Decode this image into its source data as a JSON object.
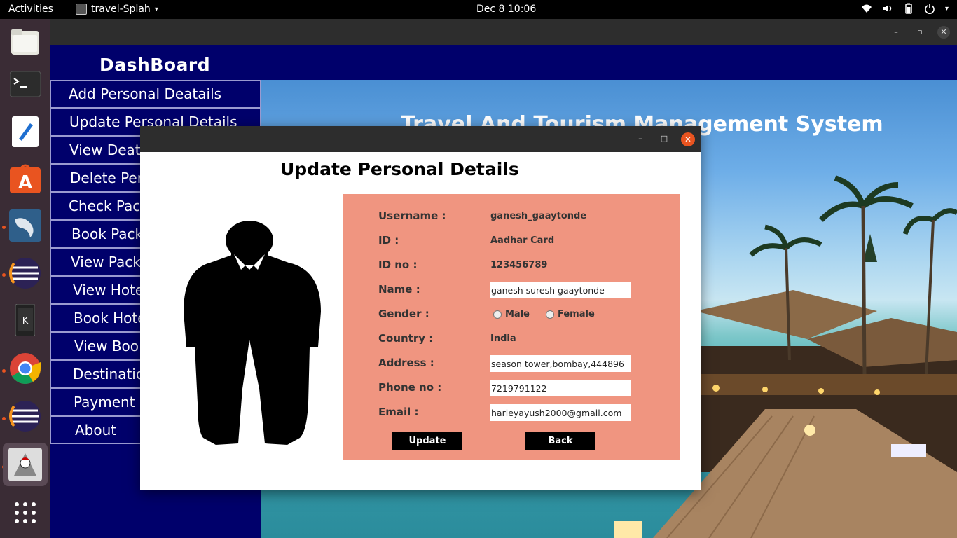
{
  "topbar": {
    "activities": "Activities",
    "app_name": "travel-Splah",
    "clock": "Dec 8  10:06"
  },
  "window": {
    "minimize": "–",
    "maximize": "▫",
    "close": "✕"
  },
  "sidebar": {
    "title": "DashBoard",
    "items": [
      {
        "label": "Add Personal Deatails"
      },
      {
        "label": "Update Personal Details"
      },
      {
        "label": "View Deat"
      },
      {
        "label": "Delete Per"
      },
      {
        "label": "Check Pac"
      },
      {
        "label": "Book Pack"
      },
      {
        "label": "View Pack"
      },
      {
        "label": "View Hote"
      },
      {
        "label": "Book Hote"
      },
      {
        "label": "View Boo"
      },
      {
        "label": "Destinatio"
      },
      {
        "label": "Payment"
      },
      {
        "label": "About"
      }
    ]
  },
  "scene": {
    "title": "Travel And Tourism Management System"
  },
  "dialog": {
    "heading": "Update Personal Details",
    "minimize": "–",
    "maximize": "□",
    "close": "✕",
    "form": {
      "username_label": "Username :",
      "username_value": "ganesh_gaaytonde",
      "id_label": "ID :",
      "id_value": "Aadhar Card",
      "idno_label": "ID no :",
      "idno_value": "123456789",
      "name_label": "Name :",
      "name_value": "ganesh suresh gaaytonde",
      "gender_label": "Gender :",
      "gender_options": [
        "Male",
        "Female"
      ],
      "country_label": "Country :",
      "country_value": "India",
      "address_label": "Address :",
      "address_value": "season tower,bombay,444896",
      "phone_label": "Phone no :",
      "phone_value": "7219791122",
      "email_label": "Email :",
      "email_value": "harleyayush2000@gmail.com",
      "update_label": "Update",
      "back_label": "Back"
    }
  },
  "colors": {
    "sidebar_bg": "#00006b",
    "form_panel_bg": "#f09580",
    "close_button": "#e95420"
  }
}
